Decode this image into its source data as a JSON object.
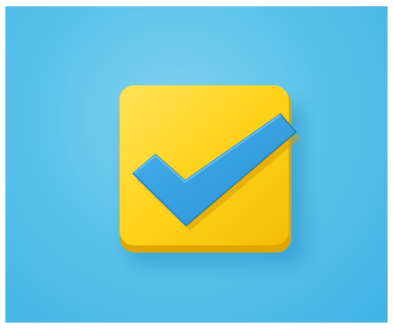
{
  "image": {
    "subject": "checkbox-icon",
    "colors": {
      "background": "#5cc3ea",
      "background_light": "#84d2ee",
      "background_dark": "#3fb3e4",
      "tile": "#ffd21a",
      "tile_highlight": "#ffe45a",
      "tile_shadow": "#e0a600",
      "check": "#2f9ee0",
      "check_edge": "#1f7fc0"
    }
  }
}
